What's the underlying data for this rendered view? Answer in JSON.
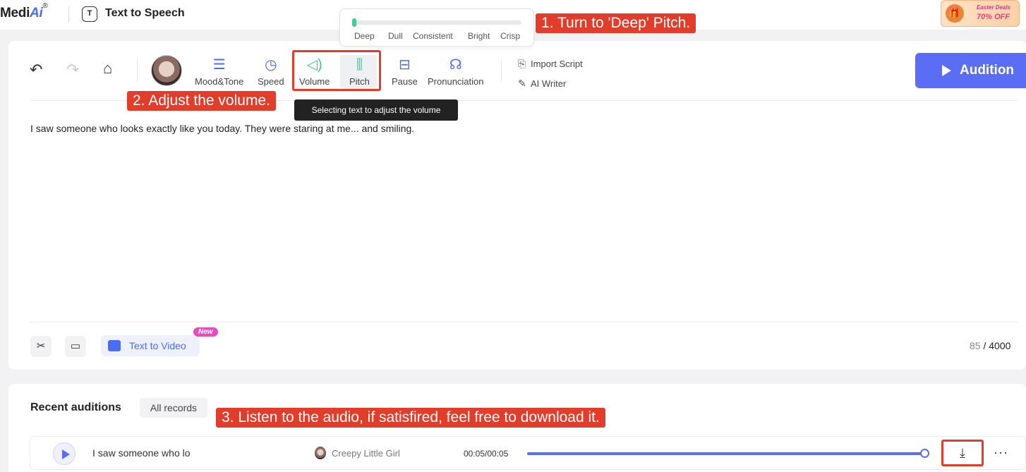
{
  "app": {
    "logo_main": "Medi",
    "logo_ai": "Ai",
    "logo_mark": "®",
    "page_title": "Text to Speech",
    "tts_icon_glyph": "T"
  },
  "promo": {
    "line1": "Easter Deals",
    "line2": "70% OFF"
  },
  "pitch_popover": {
    "options": [
      "Deep",
      "Dull",
      "Consistent",
      "Bright",
      "Crisp"
    ],
    "selected": "Deep"
  },
  "callouts": {
    "step1": "1. Turn to 'Deep' Pitch.",
    "step2": "2. Adjust the volume.",
    "step3": "3. Listen to the audio, if satisfired, feel free to download it."
  },
  "toolbar": {
    "mood_tone": "Mood&Tone",
    "speed": "Speed",
    "volume": "Volume",
    "pitch": "Pitch",
    "pause": "Pause",
    "pronunciation": "Pronunciation",
    "import_script": "Import Script",
    "ai_writer": "AI Writer",
    "audition": "Audition"
  },
  "tooltip": "Selecting text to adjust the volume",
  "editor": {
    "text": "I saw someone who looks exactly like you today. They were staring at me... and smiling.",
    "char_count": "85",
    "char_separator": "/",
    "char_max": "4000"
  },
  "bottom_tools": {
    "text_to_video": "Text to Video",
    "new_badge": "New"
  },
  "recent": {
    "title": "Recent auditions",
    "all_records": "All records",
    "rows": [
      {
        "text": "I saw someone who lo",
        "voice": "Creepy Little Girl",
        "time": "00:05/00:05",
        "progress": 1.0
      }
    ]
  },
  "colors": {
    "accent": "#5b6df5",
    "callout": "#e23c2b",
    "pitch_green": "#3ccf8e"
  }
}
